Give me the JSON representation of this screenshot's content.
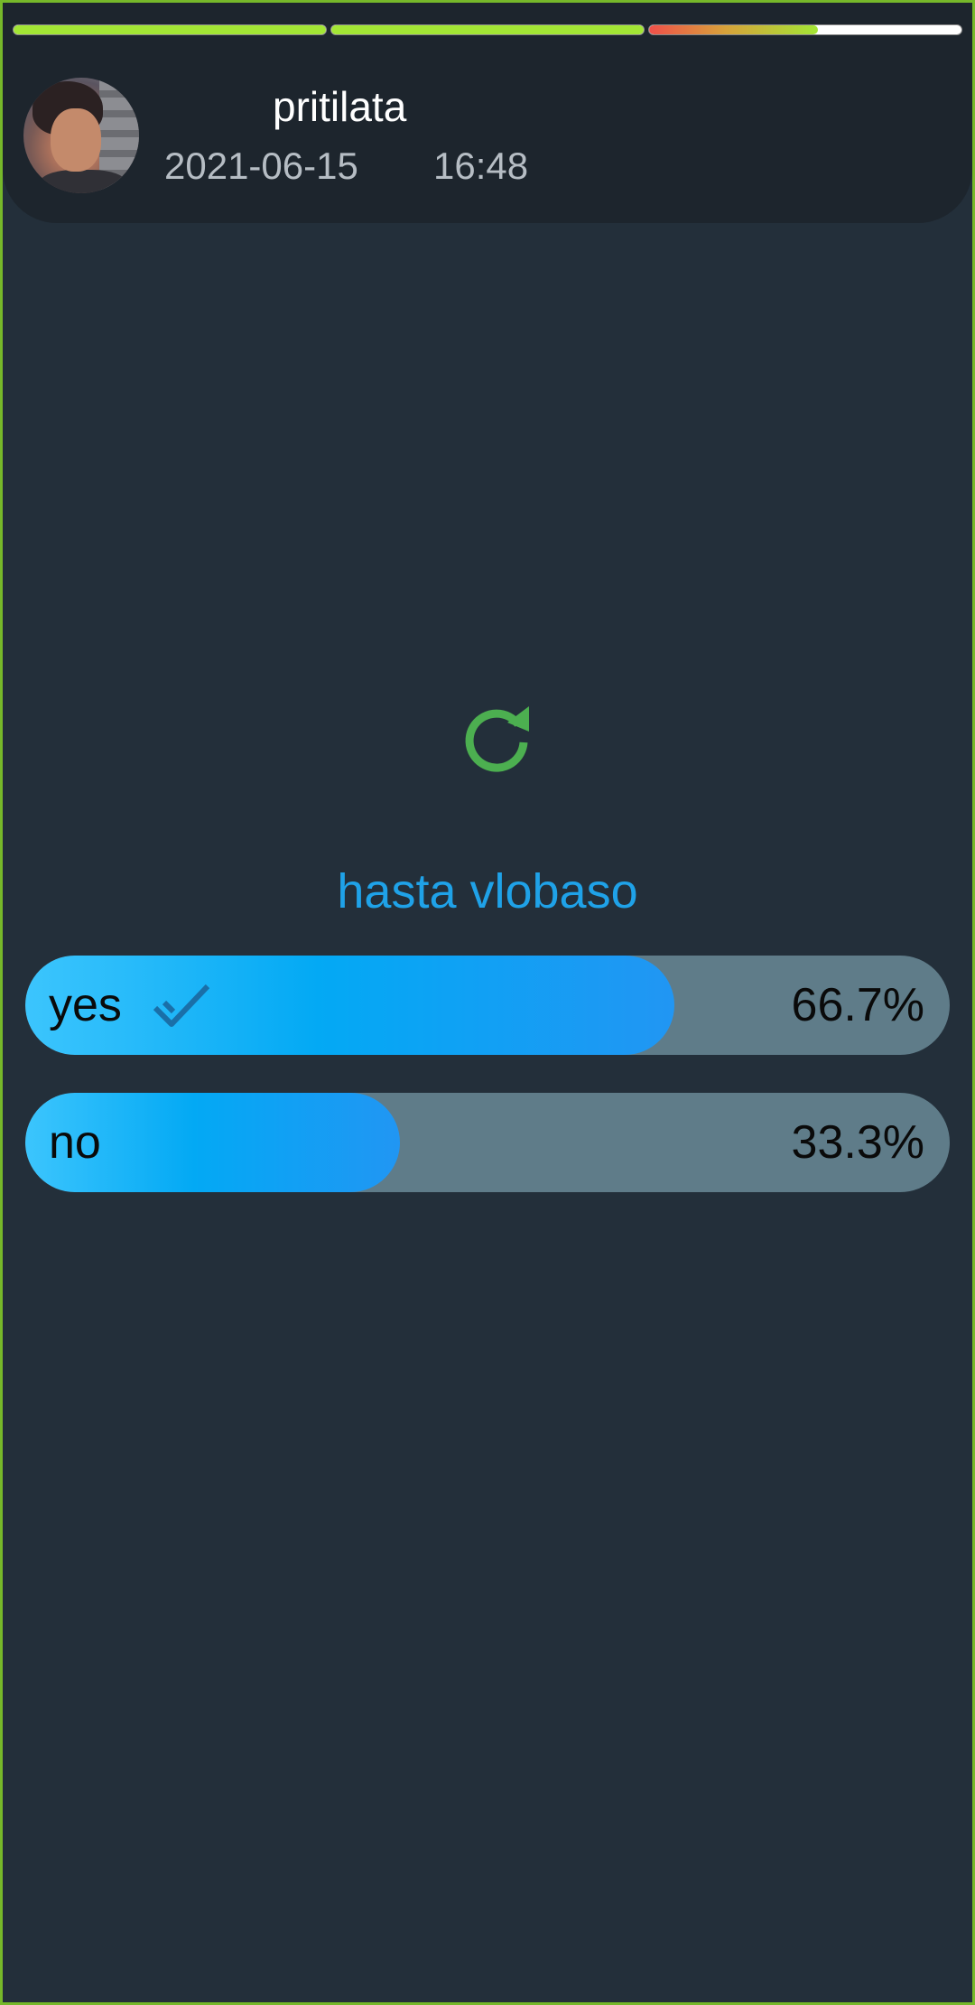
{
  "story": {
    "segments": [
      {
        "progress": 1.0
      },
      {
        "progress": 1.0
      },
      {
        "progress": 0.54
      }
    ]
  },
  "header": {
    "username": "pritilata",
    "date": "2021-06-15",
    "time": "16:48"
  },
  "poll": {
    "question": "hasta vlobaso",
    "options": [
      {
        "label": "yes",
        "percent": "66.7%",
        "fraction": 0.702,
        "selected": true
      },
      {
        "label": "no",
        "percent": "33.3%",
        "fraction": 0.405,
        "selected": false
      }
    ]
  },
  "colors": {
    "background": "#232f3a",
    "header": "#1d252d",
    "accent": "#1fa2e8",
    "refresh": "#4caf50",
    "progress": "#a3e635",
    "frame": "#76b82a"
  },
  "icons": {
    "refresh": "refresh-icon",
    "check": "check-icon"
  }
}
